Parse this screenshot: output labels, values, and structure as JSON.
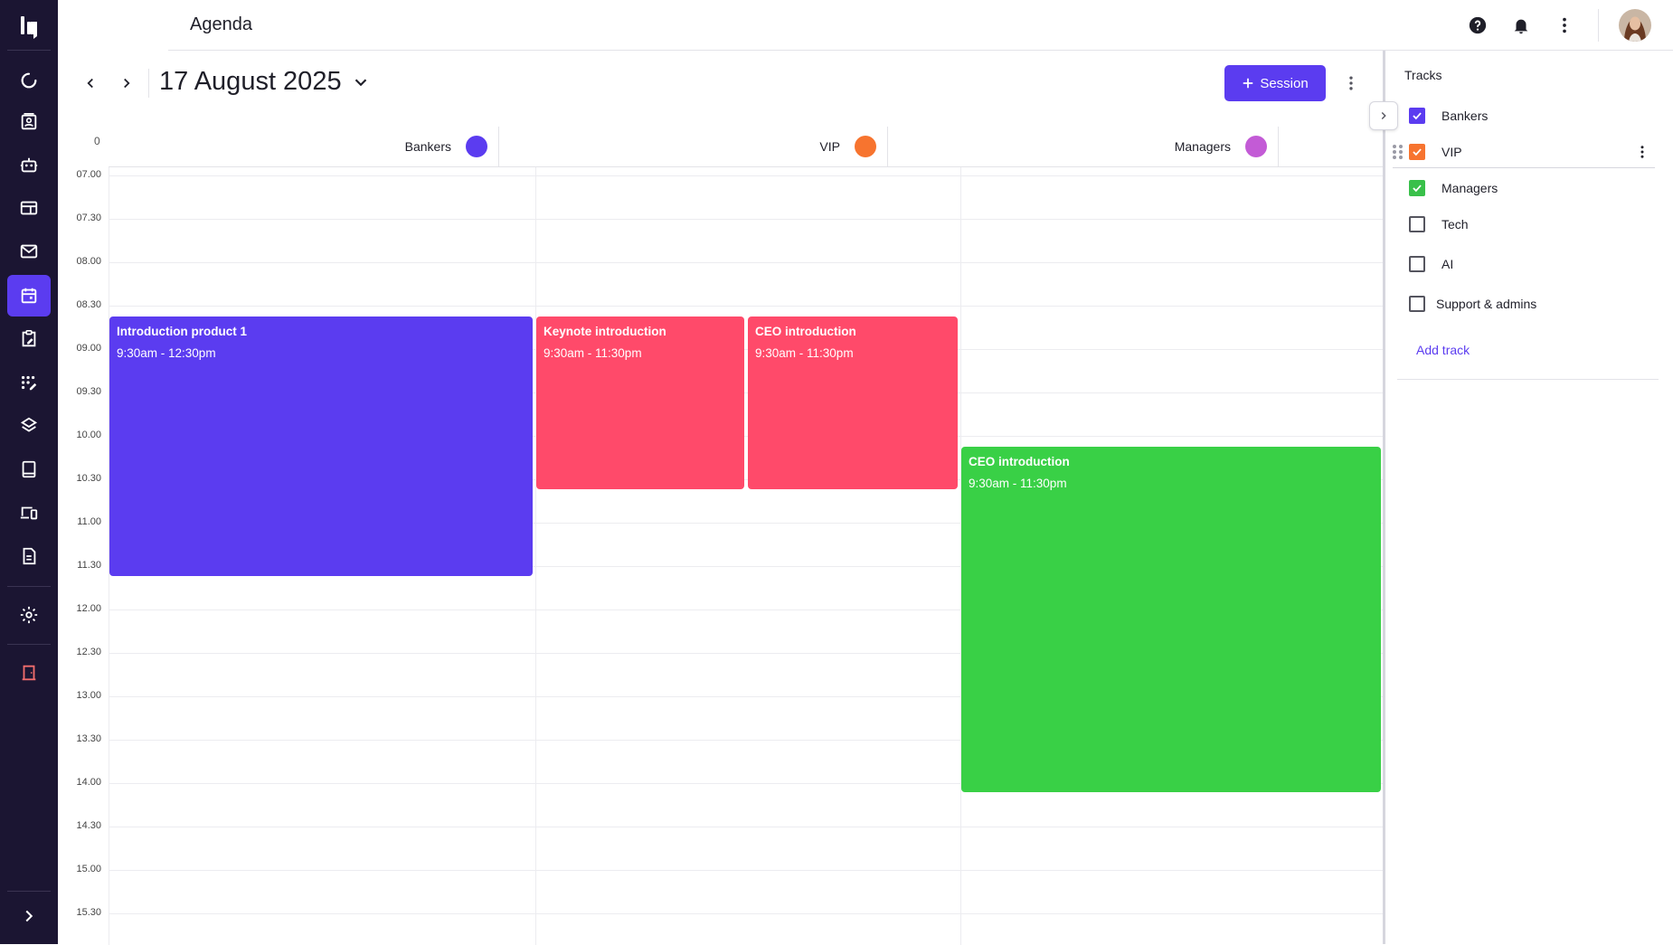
{
  "app": {
    "title": "Agenda"
  },
  "nav": {
    "items": [
      {
        "icon": "refresh-circle-icon"
      },
      {
        "icon": "contacts-icon"
      },
      {
        "icon": "robot-icon"
      },
      {
        "icon": "layout-icon"
      },
      {
        "icon": "mail-icon"
      },
      {
        "icon": "calendar-icon",
        "active": true
      },
      {
        "icon": "clipboard-edit-icon"
      },
      {
        "icon": "grid-edit-icon"
      },
      {
        "icon": "layers-icon"
      },
      {
        "icon": "tablet-icon"
      },
      {
        "icon": "devices-icon"
      },
      {
        "icon": "document-icon"
      },
      {
        "icon": "settings-icon"
      },
      {
        "icon": "exit-door-icon"
      }
    ],
    "expand_icon": "chevron-right-icon"
  },
  "toolbar": {
    "date": "17 August 2025",
    "session_label": "Session"
  },
  "calendar": {
    "zero_label": "0",
    "columns": [
      {
        "name": "Bankers",
        "color": "#5b3cf0"
      },
      {
        "name": "VIP",
        "color": "#f7742f"
      },
      {
        "name": "Managers",
        "color": "#c35bd6"
      }
    ],
    "times": [
      "07.00",
      "07.30",
      "08.00",
      "08.30",
      "09.00",
      "09.30",
      "10.00",
      "10.30",
      "11.00",
      "11.30",
      "12.00",
      "12.30",
      "13.00",
      "13.30",
      "14.00",
      "14.30",
      "15.00",
      "15.30"
    ],
    "events": [
      {
        "title": "Introduction product 1",
        "time": "9:30am - 12:30pm",
        "color": "#5b3cf0"
      },
      {
        "title": "Keynote introduction",
        "time": "9:30am - 11:30pm",
        "color": "#ff4a6a"
      },
      {
        "title": "CEO introduction",
        "time": "9:30am - 11:30pm",
        "color": "#ff4a6a"
      },
      {
        "title": "CEO introduction",
        "time": "9:30am - 11:30pm",
        "color": "#39d046"
      }
    ]
  },
  "tracks": {
    "title": "Tracks",
    "items": [
      {
        "label": "Bankers",
        "checked": true,
        "color": "#5b3cf0"
      },
      {
        "label": "VIP",
        "checked": true,
        "color": "#f7742f"
      },
      {
        "label": "Managers",
        "checked": true,
        "color": "#39c04a"
      },
      {
        "label": "Tech",
        "checked": false
      },
      {
        "label": "AI",
        "checked": false
      },
      {
        "label": "Support & admins",
        "checked": false
      }
    ],
    "add_label": "Add track"
  }
}
